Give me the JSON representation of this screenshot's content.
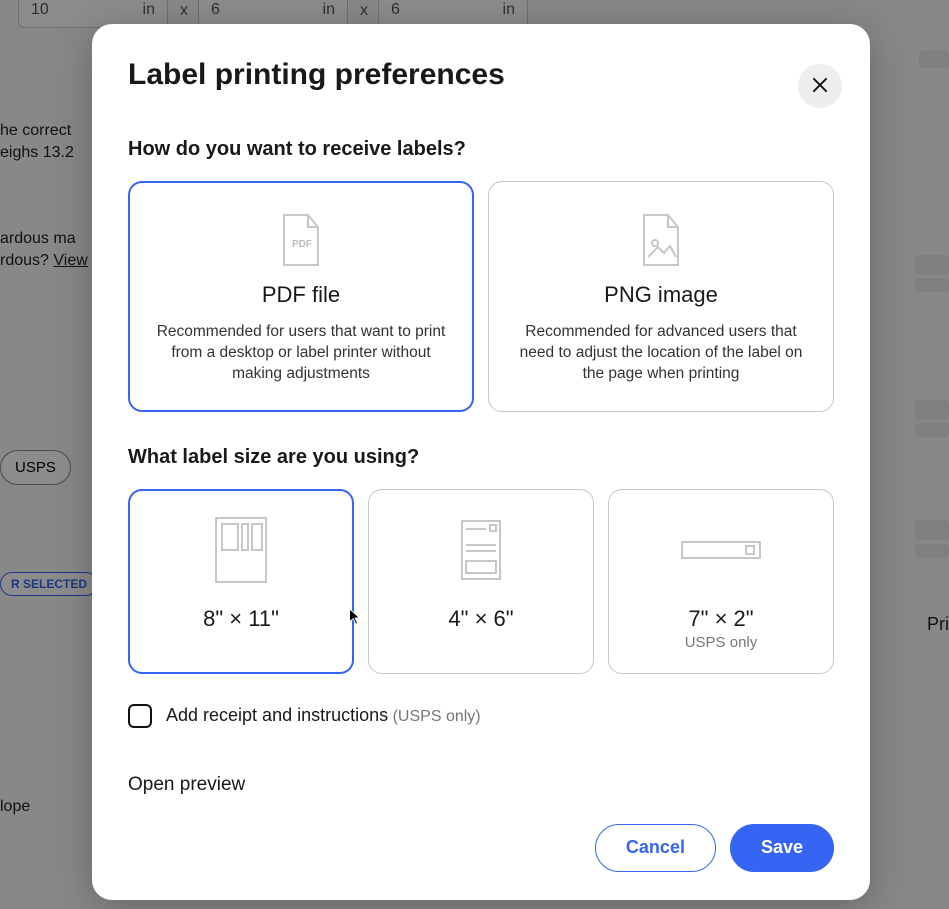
{
  "background": {
    "dims_value_a": "10",
    "dims_unit_a": "in",
    "dims_sep1": "x",
    "dims_value_b": "6",
    "dims_unit_b": "in",
    "dims_sep2": "x",
    "dims_value_c": "6",
    "dims_unit_c": "in",
    "pkg_line1": "he correct",
    "pkg_line2": "eighs 13.2",
    "haz_line1": "ardous ma",
    "haz_line2": "rdous?",
    "haz_view": "View",
    "carrier_pill": "USPS",
    "selected_pill": "R SELECTED",
    "lope": "lope",
    "print_side": "Pri"
  },
  "modal": {
    "title": "Label printing preferences",
    "q1": "How do you want to receive labels?",
    "format_options": {
      "pdf": {
        "title": "PDF file",
        "desc": "Recommended for users that want to print from a desktop or label printer without making adjustments",
        "badge": "PDF",
        "selected": true
      },
      "png": {
        "title": "PNG image",
        "desc": "Recommended for advanced users that need to adjust the location of the label on the page when printing",
        "selected": false
      }
    },
    "q2": "What label size are you using?",
    "size_options": {
      "a": {
        "label": "8\" × 11\"",
        "sub": "",
        "selected": true
      },
      "b": {
        "label": "4\" × 6\"",
        "sub": "",
        "selected": false
      },
      "c": {
        "label": "7\" × 2\"",
        "sub": "USPS only",
        "selected": false
      }
    },
    "receipt_checkbox": {
      "label": "Add receipt and instructions",
      "hint": "(USPS only)",
      "checked": false
    },
    "open_preview": "Open preview",
    "buttons": {
      "cancel": "Cancel",
      "save": "Save"
    }
  }
}
